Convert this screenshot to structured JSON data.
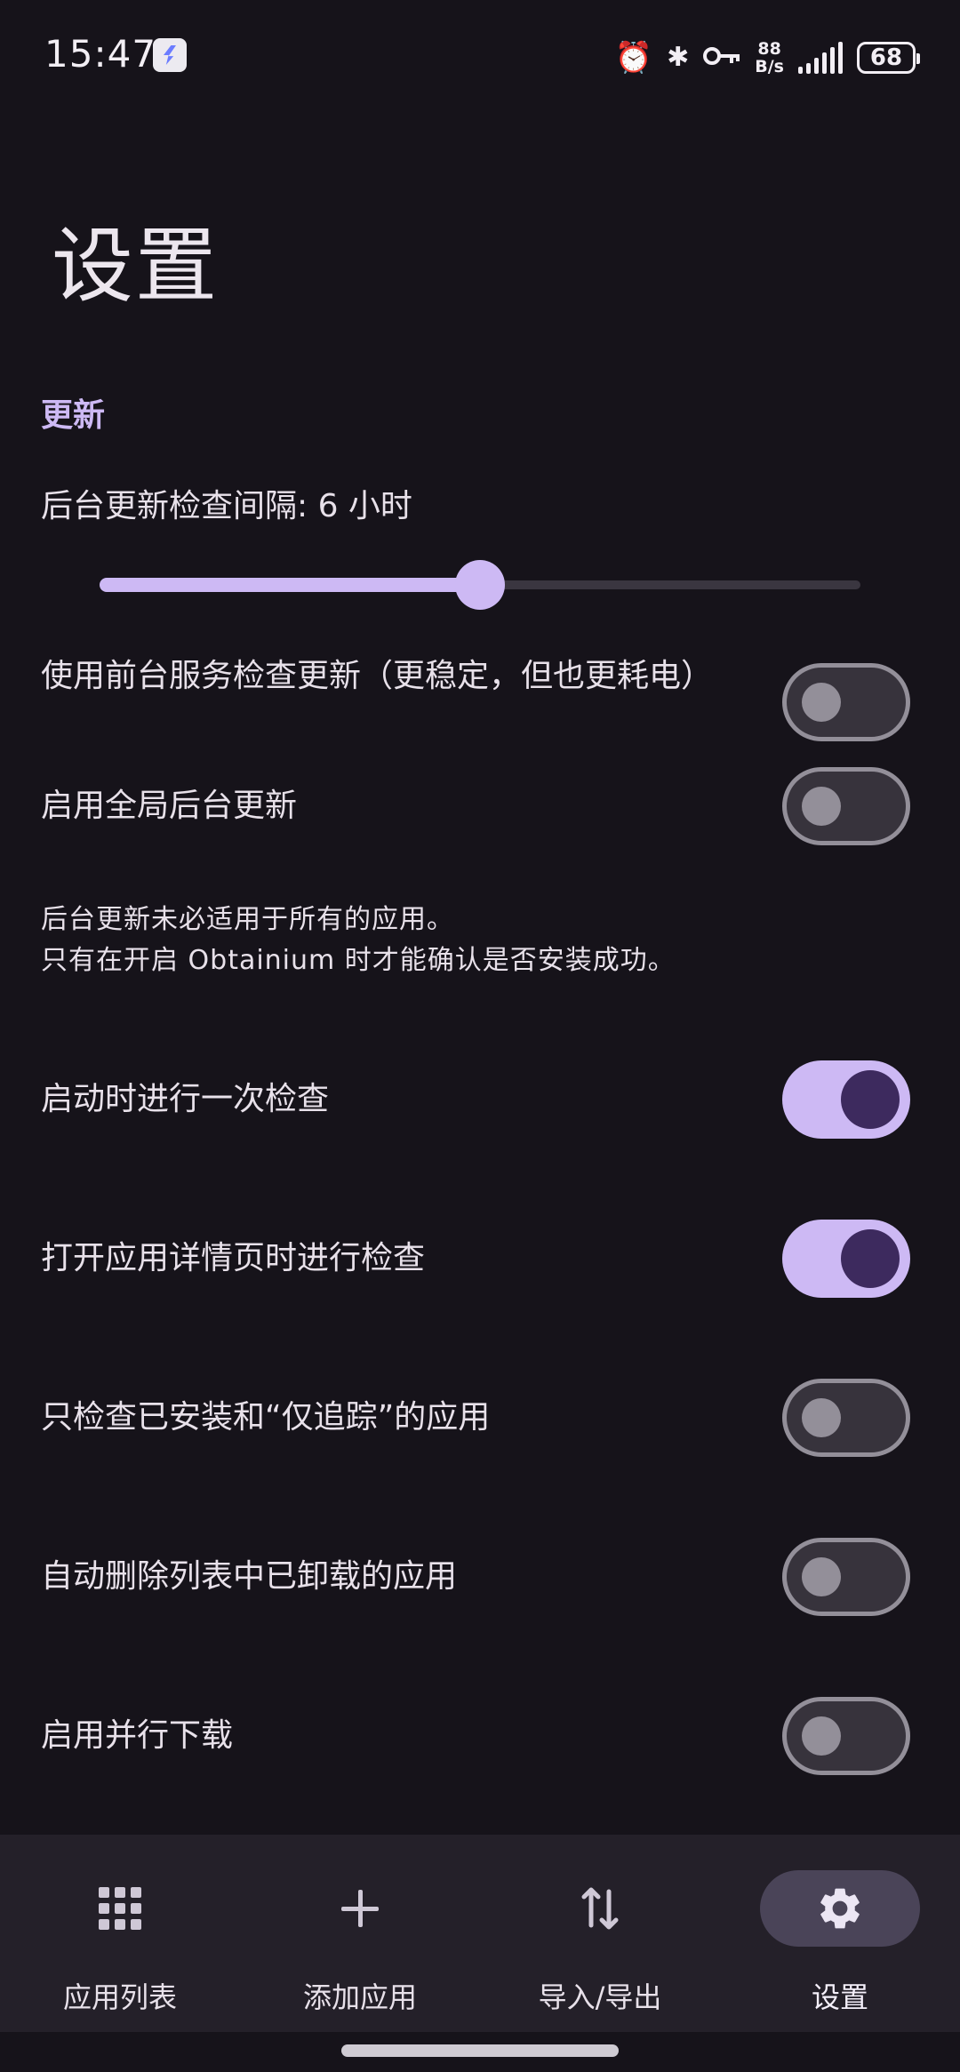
{
  "status_bar": {
    "time": "15:47",
    "net_speed_value": "88",
    "net_speed_unit": "B/s",
    "battery": "68",
    "icons": [
      "alarm-icon",
      "bluetooth-icon",
      "key-icon",
      "signal-icon",
      "battery-icon"
    ]
  },
  "page": {
    "title": "设置",
    "section_update": "更新"
  },
  "interval": {
    "label": "后台更新检查间隔: 6 小时",
    "slider_fraction": 0.5
  },
  "settings": [
    {
      "label": "使用前台服务检查更新（更稳定，但也更耗电）",
      "enabled": false
    },
    {
      "label": "启用全局后台更新",
      "enabled": false
    },
    {
      "label": "启动时进行一次检查",
      "enabled": true
    },
    {
      "label": "打开应用详情页时进行检查",
      "enabled": true
    },
    {
      "label": "只检查已安装和“仅追踪”的应用",
      "enabled": false
    },
    {
      "label": "自动删除列表中已卸载的应用",
      "enabled": false
    },
    {
      "label": "启用并行下载",
      "enabled": false
    }
  ],
  "note": {
    "line1": "后台更新未必适用于所有的应用。",
    "line2": "只有在开启 Obtainium 时才能确认是否安装成功。"
  },
  "nav": [
    {
      "label": "应用列表",
      "icon": "apps-grid-icon",
      "active": false
    },
    {
      "label": "添加应用",
      "icon": "plus-icon",
      "active": false
    },
    {
      "label": "导入/导出",
      "icon": "import-export-icon",
      "active": false
    },
    {
      "label": "设置",
      "icon": "gear-icon",
      "active": true
    }
  ],
  "colors": {
    "background": "#16131a",
    "accent": "#cdb9f4",
    "nav_background": "#242029"
  }
}
